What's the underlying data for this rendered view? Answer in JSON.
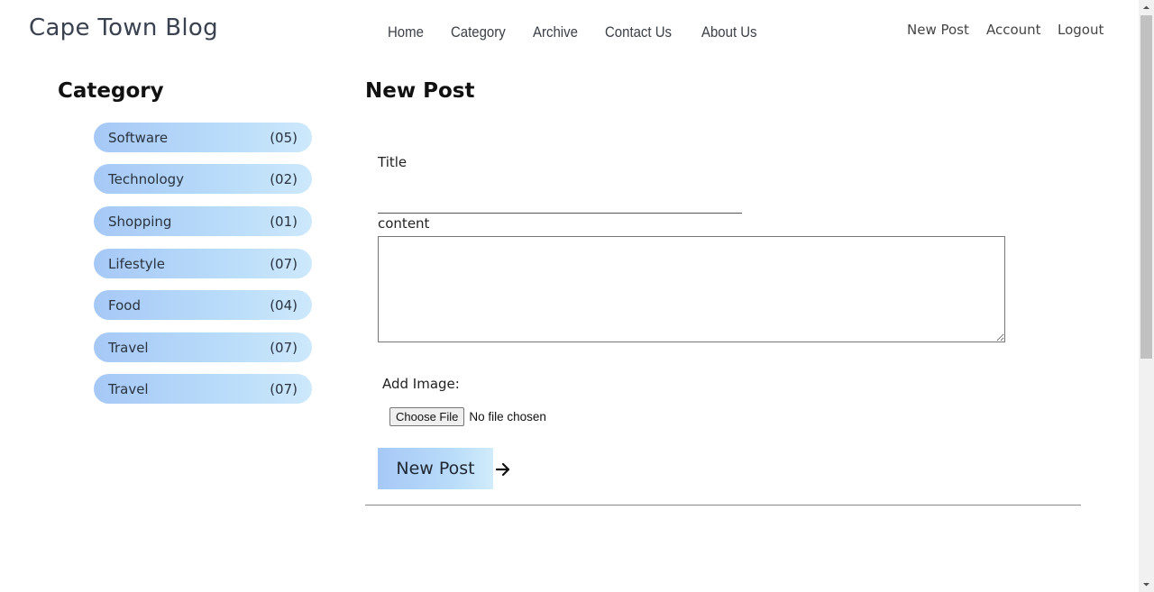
{
  "header": {
    "brand": "Cape Town Blog",
    "main_nav": [
      "Home",
      "Category",
      "Archive",
      "Contact Us",
      "About Us"
    ],
    "user_nav": [
      "New Post",
      "Account",
      "Logout"
    ]
  },
  "sidebar": {
    "title": "Category",
    "items": [
      {
        "label": "Software",
        "count": "(05)"
      },
      {
        "label": "Technology",
        "count": "(02)"
      },
      {
        "label": "Shopping",
        "count": "(01)"
      },
      {
        "label": "Lifestyle",
        "count": "(07)"
      },
      {
        "label": "Food",
        "count": "(04)"
      },
      {
        "label": "Travel",
        "count": "(07)"
      },
      {
        "label": "Travel",
        "count": "(07)"
      }
    ]
  },
  "form": {
    "heading": "New Post",
    "title_label": "Title",
    "title_value": "",
    "content_label": "content",
    "content_value": "",
    "image_label": "Add Image:",
    "file_button": "Choose File",
    "file_status": "No file chosen",
    "submit_label": "New Post"
  },
  "icons": {
    "arrow": "arrow-right-icon"
  }
}
